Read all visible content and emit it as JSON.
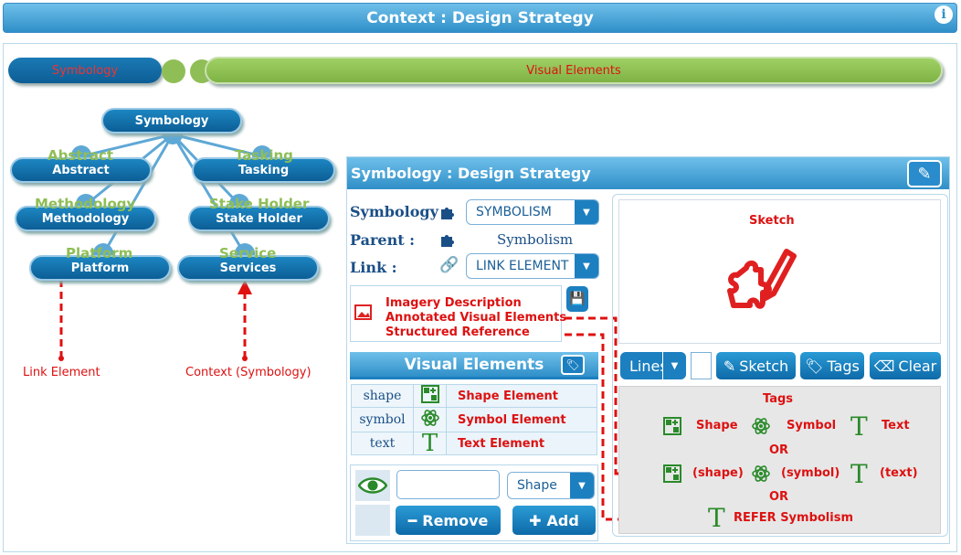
{
  "header": {
    "title": "Context : Design Strategy",
    "info_icon": "info-icon"
  },
  "tabs": {
    "symbology": "Symbology",
    "visual_elements": "Visual Elements"
  },
  "mindmap": {
    "root": "Symbology",
    "nodes": [
      {
        "label": "Abstract",
        "ghost": "Abstract"
      },
      {
        "label": "Tasking",
        "ghost": "Tasking"
      },
      {
        "label": "Methodology",
        "ghost": "Methodology"
      },
      {
        "label": "Stake Holder",
        "ghost": "Stake Holder"
      },
      {
        "label": "Platform",
        "ghost": "Platform"
      },
      {
        "label": "Services",
        "ghost": "Service"
      }
    ],
    "annotations": {
      "link_element": "Link Element",
      "context": "Context (Symbology)"
    }
  },
  "panel": {
    "title": "Symbology : Design Strategy",
    "symbology_label": "Symbology :",
    "symbology_value": "SYMBOLISM",
    "parent_label": "Parent :",
    "parent_value": "Symbolism",
    "link_label": "Link :",
    "link_value": "LINK ELEMENT",
    "textarea_lines": [
      "Imagery Description",
      "Annotated Visual Elements",
      "Structured Reference"
    ]
  },
  "visual_elements": {
    "title": "Visual Elements",
    "rows": [
      {
        "type": "shape",
        "icon": "shape-add-icon",
        "desc": "Shape Element"
      },
      {
        "type": "symbol",
        "icon": "atom-icon",
        "desc": "Symbol Element"
      },
      {
        "type": "text",
        "icon": "text-t-icon",
        "desc": "Text Element"
      }
    ],
    "input_value": "",
    "type_select": "Shape",
    "remove_label": "Remove",
    "add_label": "Add"
  },
  "sketch": {
    "title": "Sketch",
    "lines_select": "Lines",
    "sketch_btn": "Sketch",
    "tags_btn": "Tags",
    "clear_btn": "Clear"
  },
  "tags": {
    "title": "Tags",
    "row1": [
      "Shape",
      "Symbol",
      "Text"
    ],
    "or1": "OR",
    "row2": [
      "(shape)",
      "(symbol)",
      "(text)"
    ],
    "or2": "OR",
    "refer": "REFER Symbolism"
  },
  "colors": {
    "accent": "#1c7fc0",
    "green": "#8fbe56",
    "red": "#dd1111"
  }
}
